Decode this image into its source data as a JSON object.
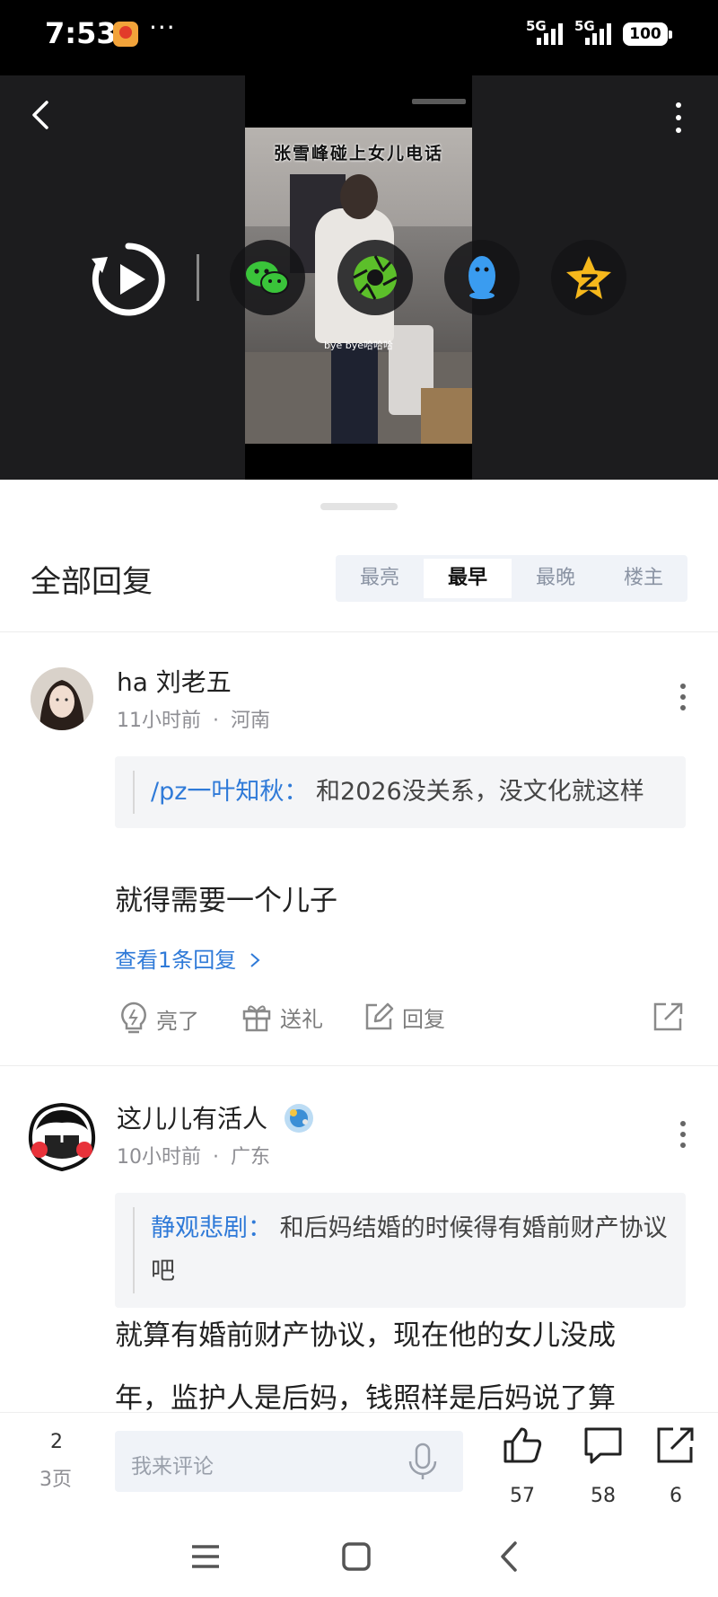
{
  "status_bar": {
    "time": "7:53",
    "dots": "···",
    "network_1": "5G",
    "network_2": "5G",
    "battery": "100"
  },
  "video": {
    "caption_top": "张雪峰碰上女儿电话",
    "subtitle": "bye bye哈哈哈"
  },
  "share_targets": [
    "wechat-icon",
    "moments-icon",
    "qq-icon",
    "qzone-icon"
  ],
  "comments_header": {
    "title": "全部回复",
    "sort_tabs": [
      {
        "label": "最亮",
        "active": false
      },
      {
        "label": "最早",
        "active": true
      },
      {
        "label": "最晚",
        "active": false
      },
      {
        "label": "楼主",
        "active": false
      }
    ]
  },
  "comments": [
    {
      "username": "ha 刘老五",
      "time": "11小时前",
      "separator": "·",
      "location": "河南",
      "quote_author": "/pz一叶知秋：",
      "quote_text": "和2026没关系，没文化就这样",
      "text": "就得需要一个儿子",
      "view_replies": "查看1条回复",
      "actions": {
        "like": "亮了",
        "gift": "送礼",
        "reply": "回复"
      }
    },
    {
      "username": "这儿儿有活人",
      "time": "10小时前",
      "separator": "·",
      "location": "广东",
      "quote_author": "静观悲剧：",
      "quote_text": "和后妈结婚的时候得有婚前财产协议吧",
      "text_line1": "就算有婚前财产协议，现在他的女儿没成",
      "text_line2": "年，监护人是后妈，钱照样是后妈说了算"
    }
  ],
  "bottom_bar": {
    "page_current": "2",
    "page_total": "3页",
    "input_placeholder": "我来评论",
    "like_count": "57",
    "comment_count": "58",
    "share_count": "6"
  },
  "colors": {
    "link_blue": "#2f7ad8",
    "video_bg": "#1c1c1e",
    "sort_bg": "#f0f3f8"
  }
}
